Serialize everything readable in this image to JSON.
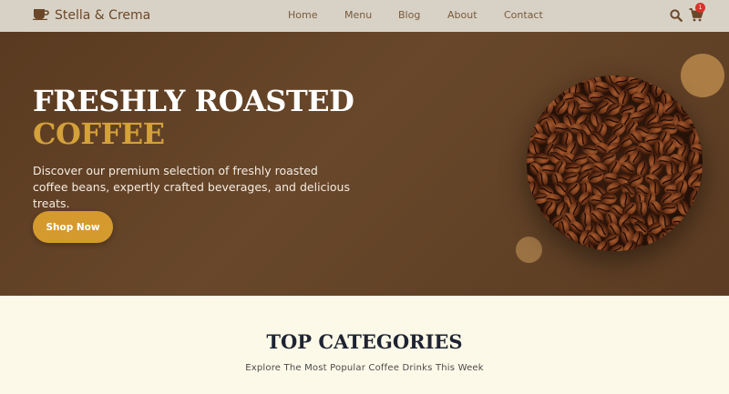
{
  "nav": {
    "brand": "Stella & Crema",
    "links": [
      "Home",
      "Menu",
      "Blog",
      "About",
      "Contact"
    ],
    "cart_count": "1"
  },
  "hero": {
    "title_line1": "FRESHLY ROASTED",
    "title_line2": "COFFEE",
    "description": "Discover our premium selection of freshly roasted coffee beans, expertly crafted beverages, and delicious treats.",
    "cta_label": "Shop Now"
  },
  "categories": {
    "title": "TOP CATEGORIES",
    "subtitle": "Explore The Most Popular Coffee Drinks This Week"
  },
  "icons": {
    "logo": "coffee-cup-icon",
    "search": "search-icon",
    "cart": "cart-icon"
  },
  "colors": {
    "navbar": "#d8d2c6",
    "hero_bg": "#63432a",
    "accent": "#d4a13a",
    "button": "#d59a2e",
    "badge": "#d9322b",
    "section_bg": "#fdf9e8"
  }
}
